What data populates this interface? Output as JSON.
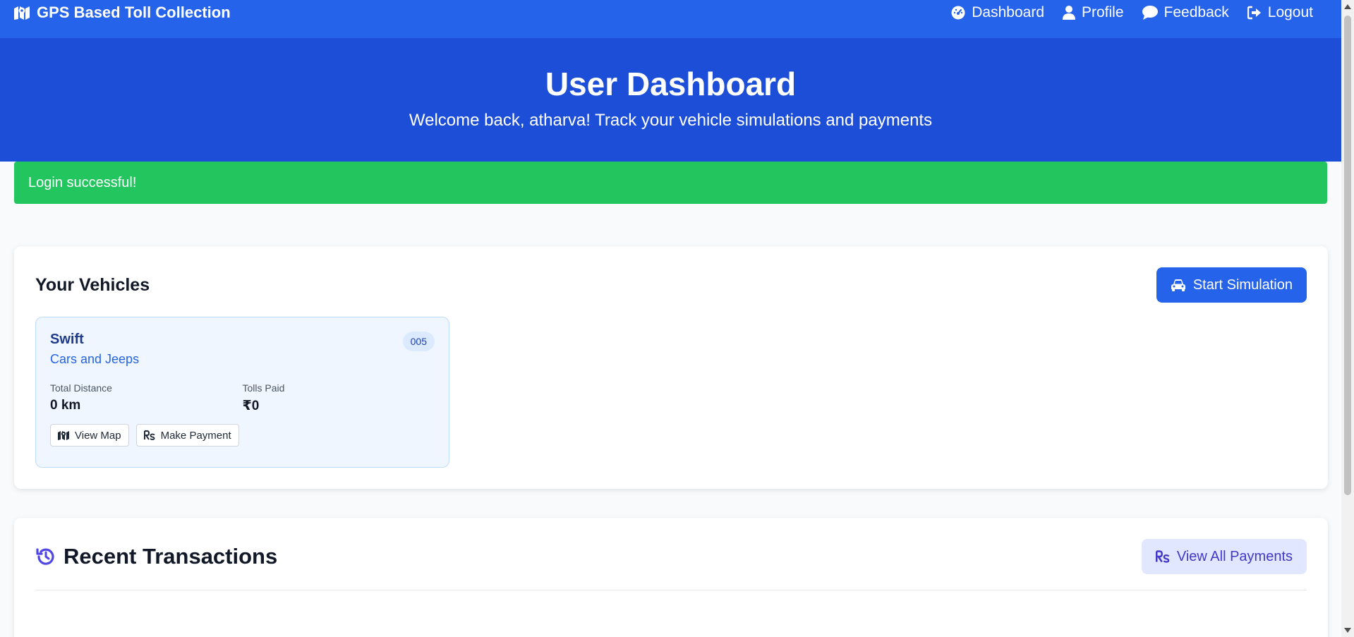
{
  "navbar": {
    "brand": "GPS Based Toll Collection",
    "brand_icon": "map-icon",
    "links": [
      {
        "label": "Dashboard",
        "icon": "gauge-icon"
      },
      {
        "label": "Profile",
        "icon": "user-icon"
      },
      {
        "label": "Feedback",
        "icon": "comment-icon"
      },
      {
        "label": "Logout",
        "icon": "logout-icon"
      }
    ]
  },
  "hero": {
    "title": "User Dashboard",
    "subtitle": "Welcome back, atharva! Track your vehicle simulations and payments"
  },
  "alert": {
    "message": "Login successful!",
    "color": "#22c55e"
  },
  "vehicles": {
    "title": "Your Vehicles",
    "start_button": "Start Simulation",
    "items": [
      {
        "name": "Swift",
        "type": "Cars and Jeeps",
        "badge": "005",
        "distance_label": "Total Distance",
        "distance_value": "0 km",
        "tolls_label": "Tolls Paid",
        "tolls_value": "₹0",
        "view_map": "View Map",
        "make_payment": "Make Payment"
      }
    ]
  },
  "transactions": {
    "title": "Recent Transactions",
    "view_all": "View All Payments"
  },
  "colors": {
    "navbar": "#2563eb",
    "hero": "#1d4ed8",
    "accent": "#2563eb",
    "soft_button": "#e0e7ff"
  }
}
